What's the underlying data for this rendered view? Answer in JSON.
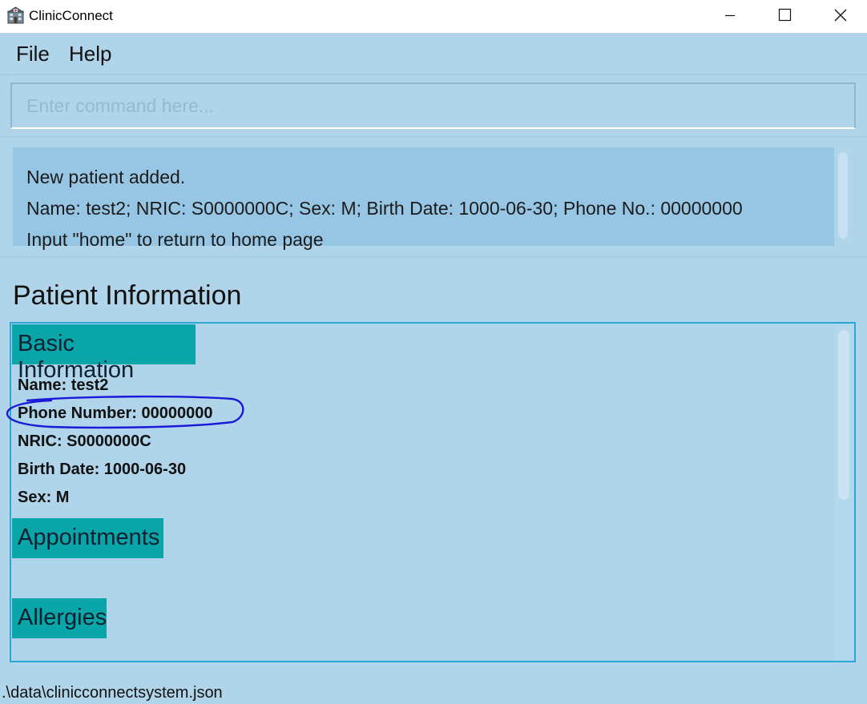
{
  "window": {
    "title": "ClinicConnect",
    "icon": "clinic-building-icon",
    "controls": [
      "minimize-icon",
      "maximize-icon",
      "close-icon"
    ]
  },
  "menu": {
    "file_label": "File",
    "help_label": "Help"
  },
  "command": {
    "placeholder": "Enter command here...",
    "value": ""
  },
  "result": {
    "line1": "New patient added.",
    "line2": "Name: test2; NRIC: S0000000C; Sex: M; Birth Date: 1000-06-30; Phone No.: 00000000",
    "line3": "Input \"home\" to return to home page"
  },
  "patient_panel": {
    "title": "Patient Information",
    "basic_header": "Basic Information",
    "name": "Name: test2",
    "phone": "Phone Number: 00000000",
    "nric": "NRIC: S0000000C",
    "birth_date": "Birth Date: 1000-06-30",
    "sex": "Sex: M",
    "appointments_header": "Appointments",
    "allergies_header": "Allergies"
  },
  "status": {
    "file_path": ".\\data\\clinicconnectsystem.json"
  },
  "colors": {
    "background": "#b0d5ea",
    "result_box": "#97c6e4",
    "section_header": "#0aa5a8",
    "panel_border": "#2ea6d4",
    "annotation": "#1a1ad8"
  }
}
